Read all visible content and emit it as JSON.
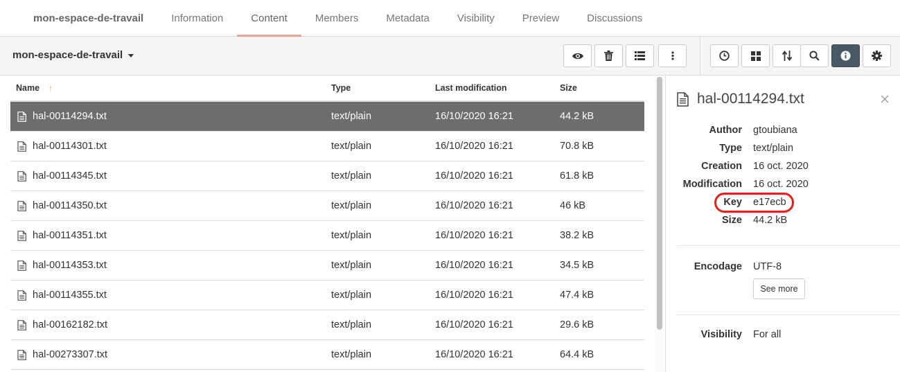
{
  "tabs": {
    "brand": "mon-espace-de-travail",
    "items": [
      {
        "label": "Information"
      },
      {
        "label": "Content"
      },
      {
        "label": "Members"
      },
      {
        "label": "Metadata"
      },
      {
        "label": "Visibility"
      },
      {
        "label": "Preview"
      },
      {
        "label": "Discussions"
      }
    ],
    "active": "Content"
  },
  "toolbar": {
    "workspace_name": "mon-espace-de-travail",
    "left_buttons": [
      "eye-icon",
      "trash-icon",
      "list-icon",
      "more-vertical-icon"
    ],
    "right_buttons": [
      "clock-icon",
      "grid-icon",
      "sort-icon",
      "search-icon",
      "info-icon",
      "gear-icon"
    ],
    "active_button": "info-icon",
    "active_color": "#4a5968"
  },
  "table": {
    "headers": {
      "name": "Name",
      "type": "Type",
      "modified": "Last modification",
      "size": "Size"
    },
    "rows": [
      {
        "name": "hal-00114294.txt",
        "type": "text/plain",
        "modified": "16/10/2020 16:21",
        "size": "44.2 kB"
      },
      {
        "name": "hal-00114301.txt",
        "type": "text/plain",
        "modified": "16/10/2020 16:21",
        "size": "70.8 kB"
      },
      {
        "name": "hal-00114345.txt",
        "type": "text/plain",
        "modified": "16/10/2020 16:21",
        "size": "61.8 kB"
      },
      {
        "name": "hal-00114350.txt",
        "type": "text/plain",
        "modified": "16/10/2020 16:21",
        "size": "46 kB"
      },
      {
        "name": "hal-00114351.txt",
        "type": "text/plain",
        "modified": "16/10/2020 16:21",
        "size": "38.2 kB"
      },
      {
        "name": "hal-00114353.txt",
        "type": "text/plain",
        "modified": "16/10/2020 16:21",
        "size": "34.5 kB"
      },
      {
        "name": "hal-00114355.txt",
        "type": "text/plain",
        "modified": "16/10/2020 16:21",
        "size": "47.4 kB"
      },
      {
        "name": "hal-00162182.txt",
        "type": "text/plain",
        "modified": "16/10/2020 16:21",
        "size": "29.6 kB"
      },
      {
        "name": "hal-00273307.txt",
        "type": "text/plain",
        "modified": "16/10/2020 16:21",
        "size": "64.4 kB"
      }
    ]
  },
  "panel": {
    "file_name": "hal-00114294.txt",
    "meta": [
      {
        "key": "Author",
        "value": "gtoubiana"
      },
      {
        "key": "Type",
        "value": "text/plain"
      },
      {
        "key": "Creation",
        "value": "16 oct. 2020"
      },
      {
        "key": "Modification",
        "value": "16 oct. 2020"
      },
      {
        "key": "Key",
        "value": "e17ecb"
      },
      {
        "key": "Size",
        "value": "44.2 kB"
      }
    ],
    "encoding": {
      "key": "Encodage",
      "value": "UTF-8"
    },
    "see_more": "See more",
    "visibility": {
      "key": "Visibility",
      "value": "For all"
    },
    "highlight_color": "#e3201a"
  }
}
